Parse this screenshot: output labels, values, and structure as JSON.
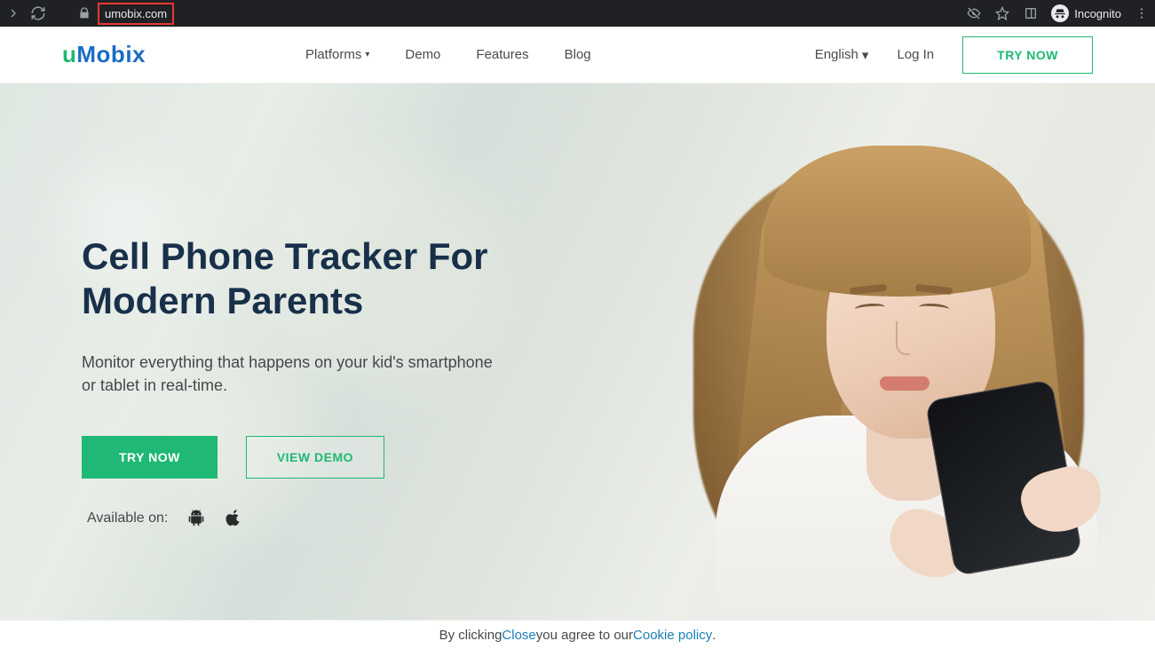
{
  "browser": {
    "url": "umobix.com",
    "incognito_label": "Incognito"
  },
  "header": {
    "logo_u": "u",
    "logo_rest": "Mobix",
    "nav": {
      "platforms": "Platforms",
      "demo": "Demo",
      "features": "Features",
      "blog": "Blog"
    },
    "language": "English",
    "login": "Log In",
    "try_now": "TRY NOW"
  },
  "hero": {
    "title_line1": "Cell Phone Tracker For",
    "title_line2": "Modern Parents",
    "subtitle": "Monitor everything that happens on your kid's smartphone or tablet in real-time.",
    "cta_primary": "TRY NOW",
    "cta_secondary": "VIEW DEMO",
    "available_label": "Available on:"
  },
  "cookie": {
    "prefix": "By clicking ",
    "close": "Close",
    "middle": " you agree to our ",
    "policy": "Cookie policy",
    "suffix": "."
  }
}
